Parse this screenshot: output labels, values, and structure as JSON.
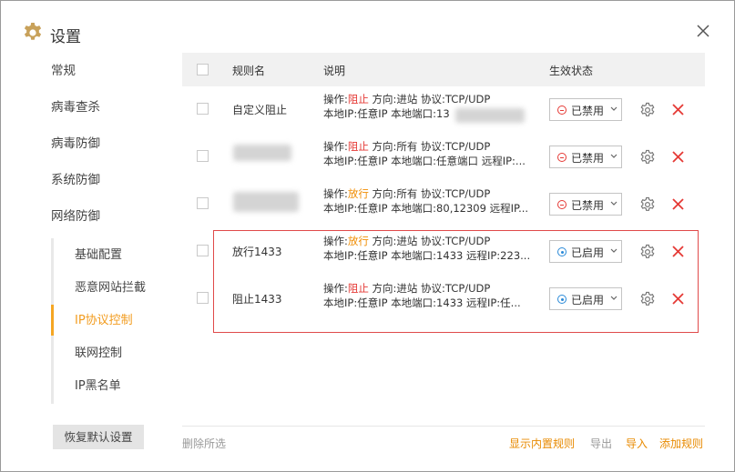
{
  "window": {
    "title": "设置",
    "title_icon": "gear-icon",
    "close_icon": "close-icon"
  },
  "sidebar": {
    "nav_items": [
      "常规",
      "病毒查杀",
      "病毒防御",
      "系统防御",
      "网络防御"
    ],
    "sub_items": [
      "基础配置",
      "恶意网站拦截",
      "IP协议控制",
      "联网控制",
      "IP黑名单"
    ],
    "active_sub_index": 2,
    "restore_button": "恢复默认设置"
  },
  "table": {
    "headers": {
      "name": "规则名",
      "desc": "说明",
      "status": "生效状态"
    },
    "rows": [
      {
        "name": "自定义阻止",
        "name_blurred": false,
        "action_prefix": "操作:",
        "action": "阻止",
        "action_type": "block",
        "line1_rest": " 方向:进站 协议:TCP/UDP",
        "line2": "本地IP:任意IP 本地端口:13",
        "status": "已禁用",
        "enabled": false
      },
      {
        "name": "",
        "name_blurred": true,
        "action_prefix": "操作:",
        "action": "阻止",
        "action_type": "block",
        "line1_rest": " 方向:所有 协议:TCP/UDP",
        "line2": "本地IP:任意IP 本地端口:任意端口 远程IP:...",
        "status": "已禁用",
        "enabled": false
      },
      {
        "name": "",
        "name_blurred": true,
        "action_prefix": "操作:",
        "action": "放行",
        "action_type": "allow",
        "line1_rest": " 方向:所有 协议:TCP/UDP",
        "line2": "本地IP:任意IP 本地端口:80,12309 远程IP...",
        "status": "已禁用",
        "enabled": false
      },
      {
        "name": "放行1433",
        "name_blurred": false,
        "action_prefix": "操作:",
        "action": "放行",
        "action_type": "allow",
        "line1_rest": " 方向:进站 协议:TCP/UDP",
        "line2": "本地IP:任意IP 本地端口:1433 远程IP:223...",
        "status": "已启用",
        "enabled": true
      },
      {
        "name": "阻止1433",
        "name_blurred": false,
        "action_prefix": "操作:",
        "action": "阻止",
        "action_type": "block",
        "line1_rest": " 方向:进站 协议:TCP/UDP",
        "line2": "本地IP:任意IP 本地端口:1433 远程IP:任...",
        "status": "已启用",
        "enabled": true
      }
    ]
  },
  "footer": {
    "delete_selected": "删除所选",
    "show_builtin": "显示内置规则",
    "export": "导出",
    "import": "导入",
    "add_rule": "添加规则"
  },
  "colors": {
    "accent": "#f29c1f",
    "block": "#e53935",
    "allow": "#f08c00",
    "highlight": "#e04a4a",
    "enabled_dot": "#2a8ad8"
  }
}
